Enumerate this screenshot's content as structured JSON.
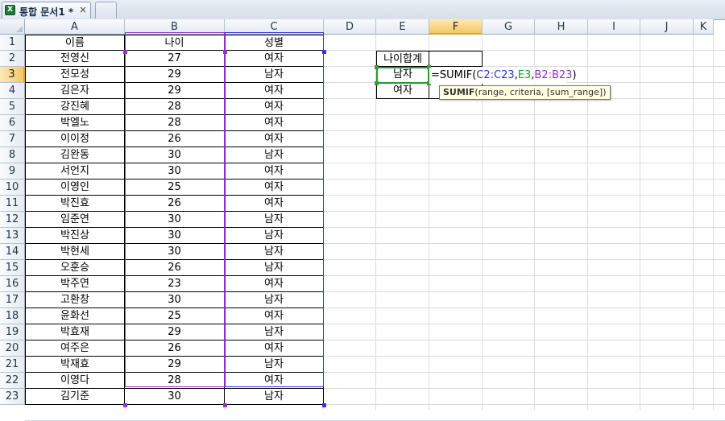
{
  "tab": {
    "title": "통합 문서1 *",
    "close_glyph": "×",
    "icon": "excel-workbook-icon"
  },
  "columns": [
    "A",
    "B",
    "C",
    "D",
    "E",
    "F",
    "G",
    "H",
    "I",
    "J",
    "K"
  ],
  "rows": [
    "1",
    "2",
    "3",
    "4",
    "5",
    "6",
    "7",
    "8",
    "9",
    "10",
    "11",
    "12",
    "13",
    "14",
    "15",
    "16",
    "17",
    "18",
    "19",
    "20",
    "21",
    "22",
    "23"
  ],
  "table": {
    "headers": [
      "이름",
      "나이",
      "성별"
    ],
    "data": [
      [
        "전영신",
        "27",
        "여자"
      ],
      [
        "전모성",
        "29",
        "남자"
      ],
      [
        "김은자",
        "29",
        "여자"
      ],
      [
        "강진혜",
        "28",
        "여자"
      ],
      [
        "박엘노",
        "28",
        "여자"
      ],
      [
        "이이정",
        "26",
        "여자"
      ],
      [
        "김완동",
        "30",
        "남자"
      ],
      [
        "서언지",
        "30",
        "여자"
      ],
      [
        "이영인",
        "25",
        "여자"
      ],
      [
        "박진효",
        "26",
        "여자"
      ],
      [
        "임준연",
        "30",
        "남자"
      ],
      [
        "박진상",
        "30",
        "남자"
      ],
      [
        "박현세",
        "30",
        "남자"
      ],
      [
        "오훈승",
        "26",
        "남자"
      ],
      [
        "박주연",
        "23",
        "여자"
      ],
      [
        "고환창",
        "30",
        "남자"
      ],
      [
        "윤화선",
        "25",
        "여자"
      ],
      [
        "박효재",
        "29",
        "남자"
      ],
      [
        "여주은",
        "26",
        "여자"
      ],
      [
        "박재효",
        "29",
        "남자"
      ],
      [
        "이영다",
        "28",
        "여자"
      ],
      [
        "김기준",
        "30",
        "남자"
      ]
    ]
  },
  "summary": {
    "title": "나이합계",
    "male": "남자",
    "female": "여자"
  },
  "formula": {
    "prefix": "=SUMIF(",
    "range1": "C2:C23",
    "sep1": ",",
    "criteria": "E3",
    "sep2": ",",
    "range2": "B2:B23",
    "suffix": ")"
  },
  "tooltip": {
    "fn": "SUMIF",
    "args": "(range, criteria, [sum_range])"
  },
  "colors": {
    "range_blue": "#3232e6",
    "criteria_green": "#1fa02f",
    "range_purple": "#9b30c8",
    "selected_header": "#f5c766"
  }
}
